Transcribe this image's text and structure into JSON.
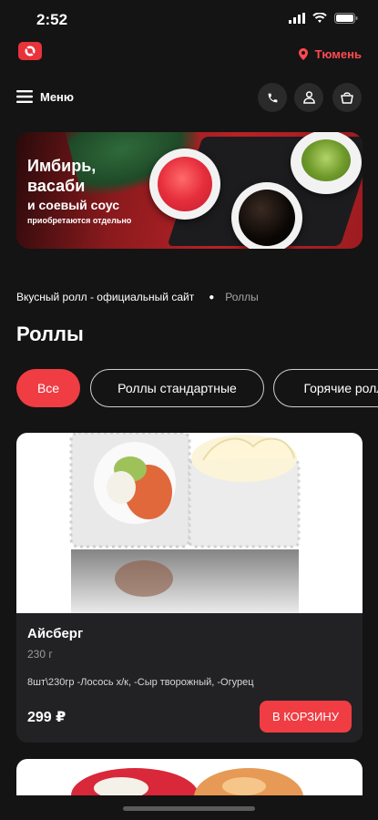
{
  "status_bar": {
    "time": "2:52"
  },
  "header": {
    "city": "Тюмень",
    "menu_label": "Меню"
  },
  "banner": {
    "title_line1": "Имбирь,",
    "title_line2": "васаби",
    "subtitle": "и соевый соус",
    "note": "приобретаются отдельно"
  },
  "breadcrumb": {
    "home": "Вкусный ролл - официальный сайт",
    "current": "Роллы"
  },
  "page_title": "Роллы",
  "filters": [
    {
      "label": "Все",
      "active": true
    },
    {
      "label": "Роллы стандартные",
      "active": false
    },
    {
      "label": "Горячие роллы",
      "active": false
    }
  ],
  "products": [
    {
      "name": "Айсберг",
      "weight": "230 г",
      "description": "8шт\\230гр -Лосось х/к, -Сыр творожный, -Огурец",
      "price": "299 ₽",
      "cart_label": "В КОРЗИНУ"
    }
  ],
  "colors": {
    "accent": "#ef3d43",
    "background": "#141414",
    "card": "#222224"
  }
}
